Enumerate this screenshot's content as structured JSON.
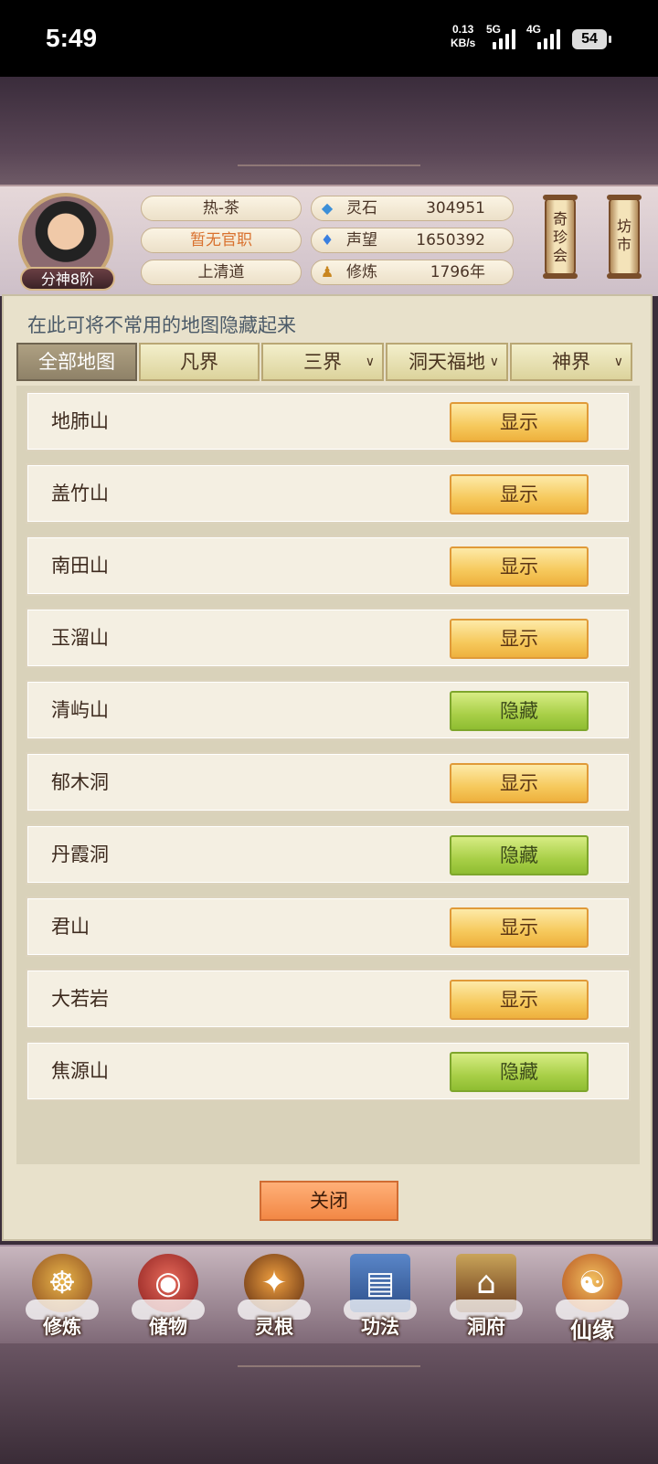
{
  "status_bar": {
    "time": "5:49",
    "speed_value": "0.13",
    "speed_unit": "KB/s",
    "net1": "5G",
    "net2": "4G",
    "battery": "54"
  },
  "player": {
    "name": "热-茶",
    "official_post": "暂无官职",
    "sect": "上清道",
    "rank": "分神8阶"
  },
  "stats": [
    {
      "label": "灵石",
      "value": "304951",
      "icon": "spirit-stone-icon"
    },
    {
      "label": "声望",
      "value": "1650392",
      "icon": "prestige-flame-icon"
    },
    {
      "label": "修炼",
      "value": "1796年",
      "icon": "meditation-icon"
    }
  ],
  "shortcuts": [
    {
      "label": "奇珍会"
    },
    {
      "label": "坊市"
    }
  ],
  "panel": {
    "tip": "在此可将不常用的地图隐藏起来",
    "tabs": [
      {
        "label": "全部地图",
        "active": true
      },
      {
        "label": "凡界",
        "active": false
      },
      {
        "label": "三界",
        "active": false,
        "dropdown": true
      },
      {
        "label": "洞天福地",
        "active": false,
        "dropdown": true
      },
      {
        "label": "神界",
        "active": false,
        "dropdown": true
      }
    ],
    "maps": [
      {
        "name": "地肺山",
        "action": "显示",
        "state": "show"
      },
      {
        "name": "盖竹山",
        "action": "显示",
        "state": "show"
      },
      {
        "name": "南田山",
        "action": "显示",
        "state": "show"
      },
      {
        "name": "玉溜山",
        "action": "显示",
        "state": "show"
      },
      {
        "name": "清屿山",
        "action": "隐藏",
        "state": "hide"
      },
      {
        "name": "郁木洞",
        "action": "显示",
        "state": "show"
      },
      {
        "name": "丹霞洞",
        "action": "隐藏",
        "state": "hide"
      },
      {
        "name": "君山",
        "action": "显示",
        "state": "show"
      },
      {
        "name": "大若岩",
        "action": "显示",
        "state": "show"
      },
      {
        "name": "焦源山",
        "action": "隐藏",
        "state": "hide"
      }
    ],
    "close_label": "关闭",
    "colors": {
      "show": "#f6c95c",
      "hide": "#a8cf47",
      "close": "#f28845"
    }
  },
  "bottom_nav": [
    {
      "label": "修炼",
      "icon": "cultivation-icon",
      "glyph": "☸"
    },
    {
      "label": "储物",
      "icon": "storage-bag-icon",
      "glyph": "◉"
    },
    {
      "label": "灵根",
      "icon": "spirit-root-icon",
      "glyph": "✦"
    },
    {
      "label": "功法",
      "icon": "manual-book-icon",
      "glyph": "▤"
    },
    {
      "label": "洞府",
      "icon": "cave-dwelling-icon",
      "glyph": "⌂"
    },
    {
      "label": "仙缘",
      "icon": "immortal-fate-icon",
      "glyph": "☯"
    }
  ]
}
